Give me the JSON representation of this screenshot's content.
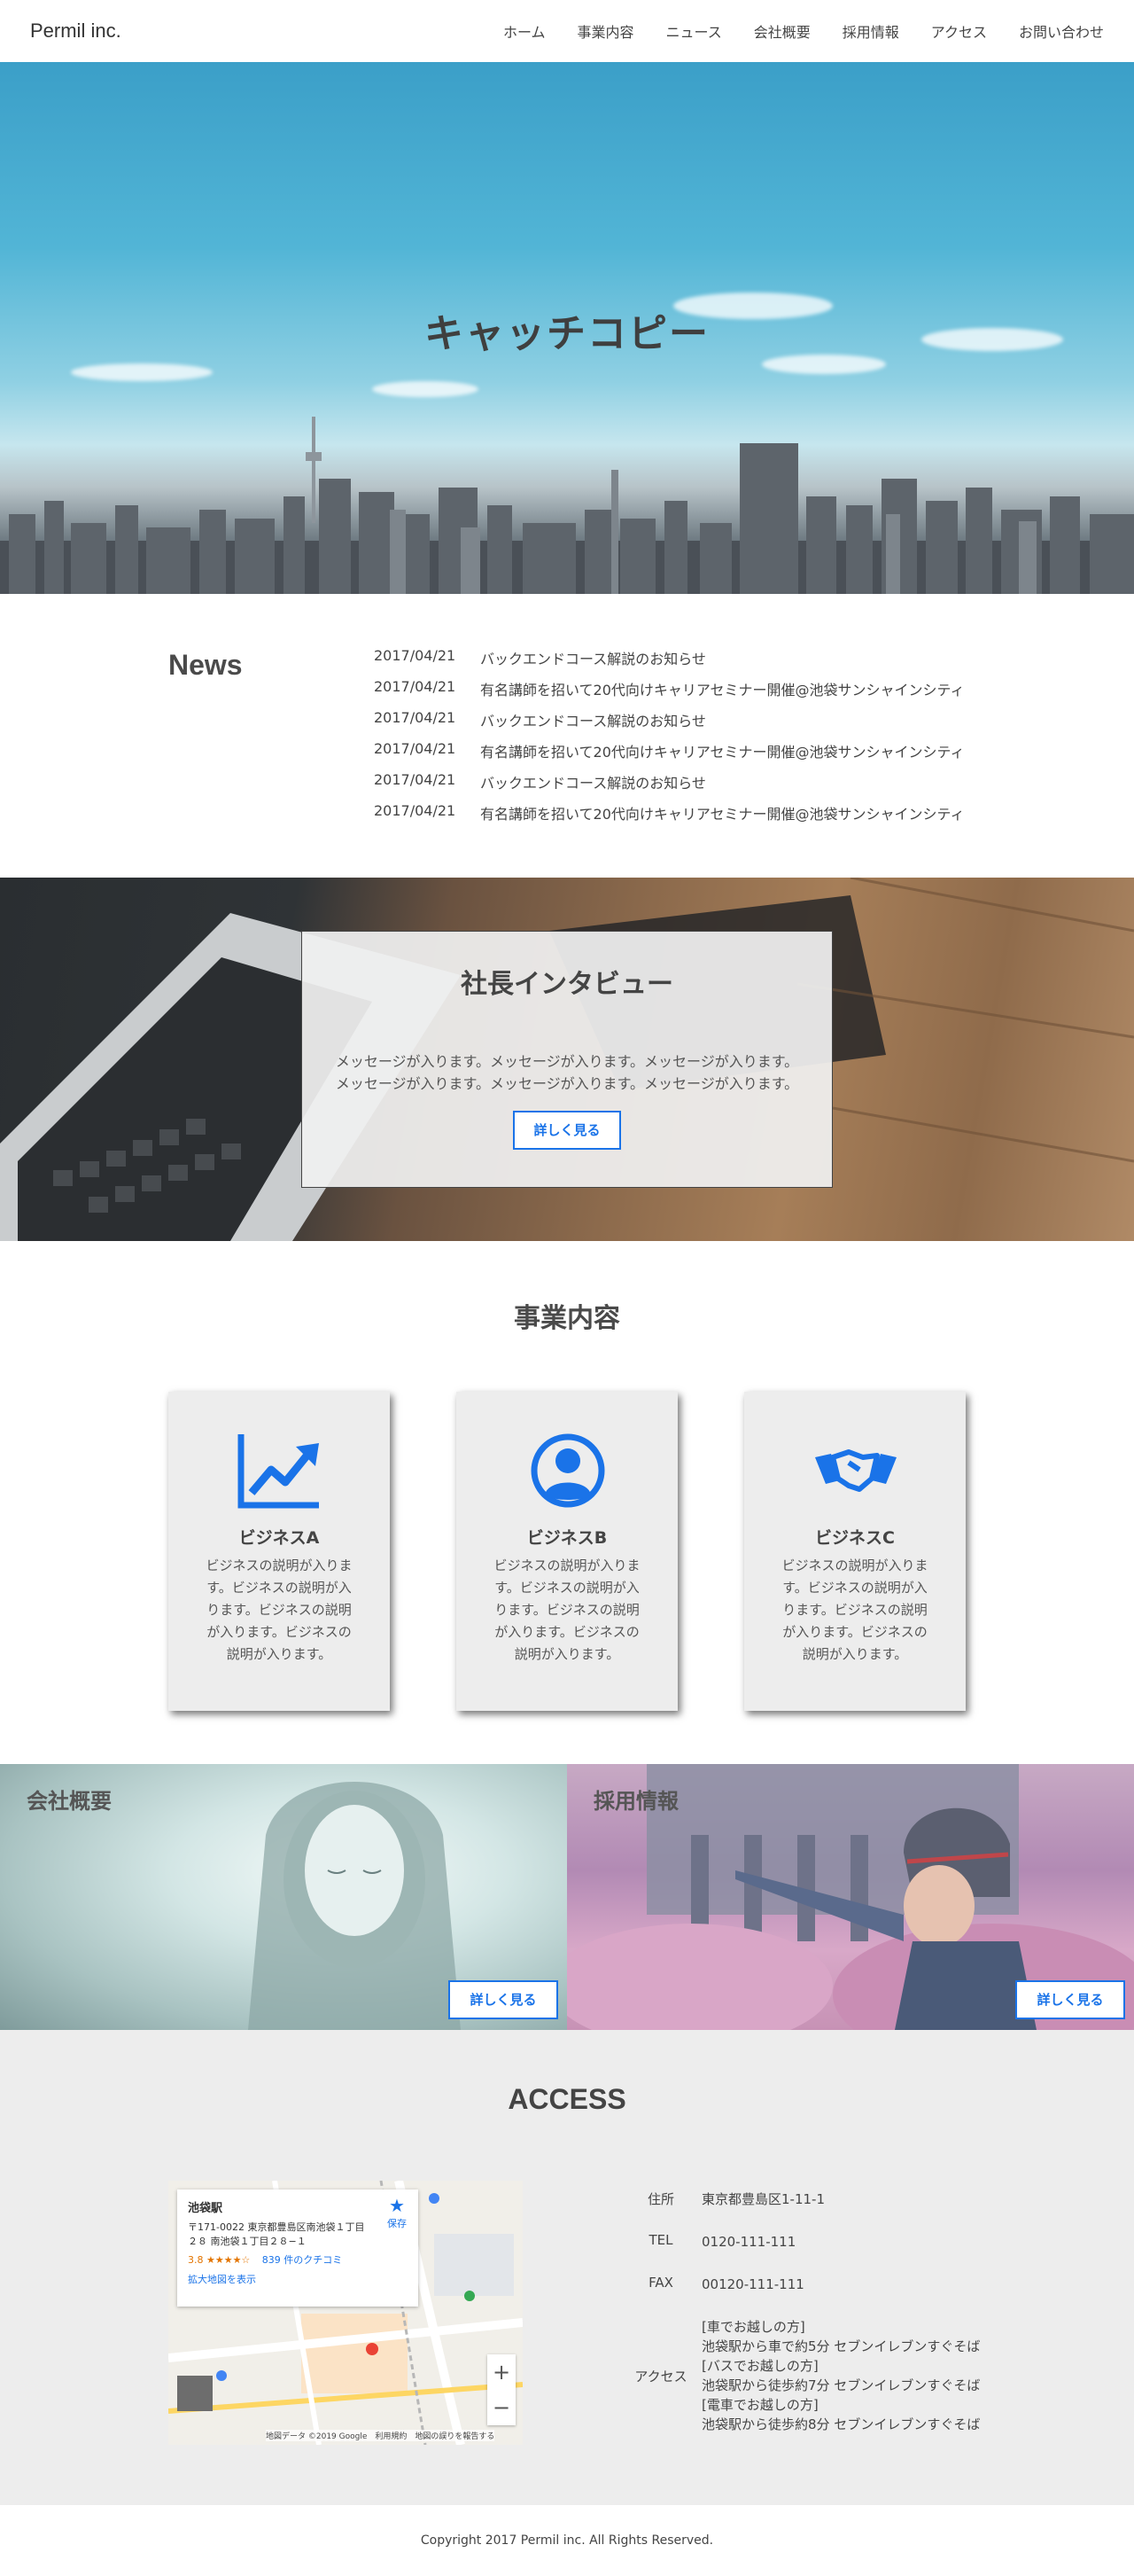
{
  "header": {
    "logo": "Permil inc.",
    "nav": [
      "ホーム",
      "事業内容",
      "ニュース",
      "会社概要",
      "採用情報",
      "アクセス",
      "お問い合わせ"
    ]
  },
  "hero": {
    "title": "キャッチコピー"
  },
  "news": {
    "heading": "News",
    "items": [
      {
        "date": "2017/04/21",
        "text": "バックエンドコース解説のお知らせ"
      },
      {
        "date": "2017/04/21",
        "text": "有名講師を招いて20代向けキャリアセミナー開催@池袋サンシャインシティ"
      },
      {
        "date": "2017/04/21",
        "text": "バックエンドコース解説のお知らせ"
      },
      {
        "date": "2017/04/21",
        "text": "有名講師を招いて20代向けキャリアセミナー開催@池袋サンシャインシティ"
      },
      {
        "date": "2017/04/21",
        "text": "バックエンドコース解説のお知らせ"
      },
      {
        "date": "2017/04/21",
        "text": "有名講師を招いて20代向けキャリアセミナー開催@池袋サンシャインシティ"
      }
    ]
  },
  "interview": {
    "title": "社長インタビュー",
    "message_line1": "メッセージが入ります。メッセージが入ります。メッセージが入ります。",
    "message_line2": "メッセージが入ります。メッセージが入ります。メッセージが入ります。",
    "button": "詳しく見る"
  },
  "business": {
    "heading": "事業内容",
    "cards": [
      {
        "icon": "chart-trend-icon",
        "title": "ビジネスA",
        "desc": "ビジネスの説明が入ります。ビジネスの説明が入ります。ビジネスの説明が入ります。ビジネスの説明が入ります。"
      },
      {
        "icon": "user-circle-icon",
        "title": "ビジネスB",
        "desc": "ビジネスの説明が入ります。ビジネスの説明が入ります。ビジネスの説明が入ります。ビジネスの説明が入ります。"
      },
      {
        "icon": "handshake-icon",
        "title": "ビジネスC",
        "desc": "ビジネスの説明が入ります。ビジネスの説明が入ります。ビジネスの説明が入ります。ビジネスの説明が入ります。"
      }
    ],
    "accent_color": "#1a73e8"
  },
  "panels": {
    "company": {
      "title": "会社概要",
      "button": "詳しく見る"
    },
    "recruit": {
      "title": "採用情報",
      "button": "詳しく見る"
    }
  },
  "access": {
    "heading": "ACCESS",
    "map": {
      "place": "池袋駅",
      "address_line1": "〒171-0022 東京都豊島区南池袋１丁目",
      "address_line2": "２８ 南池袋１丁目２８−１",
      "rating": "3.8 ★★★★☆",
      "reviews": "839 件のクチコミ",
      "larger_map": "拡大地図を表示",
      "save": "保存",
      "zoom_in": "+",
      "zoom_out": "−",
      "footer": "地図データ ©2019 Google　利用規約　地図の誤りを報告する"
    },
    "info": [
      {
        "label": "住所",
        "value": [
          "東京都豊島区1-11-1"
        ]
      },
      {
        "label": "TEL",
        "value": [
          "0120-111-111"
        ]
      },
      {
        "label": "FAX",
        "value": [
          "00120-111-111"
        ]
      },
      {
        "label": "アクセス",
        "value": [
          "[車でお越しの方]",
          "池袋駅から車で約5分 セブンイレブンすぐそば",
          "[バスでお越しの方]",
          "池袋駅から徒歩約7分 セブンイレブンすぐそば",
          "[電車でお越しの方]",
          "池袋駅から徒歩約8分 セブンイレブンすぐそば"
        ]
      }
    ]
  },
  "footer": {
    "copyright": "Copyright 2017 Permil inc. All Rights Reserved."
  }
}
